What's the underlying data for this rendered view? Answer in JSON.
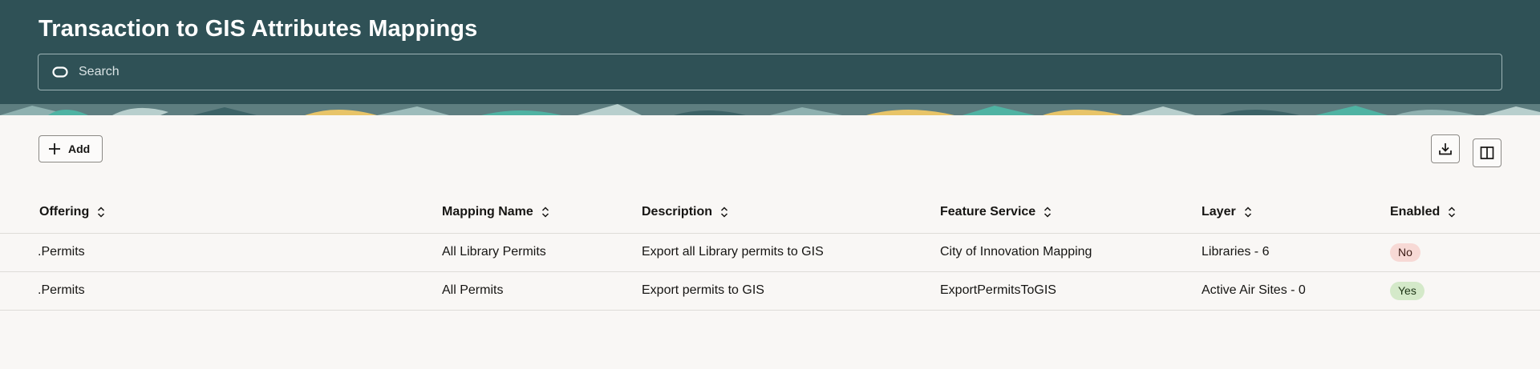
{
  "header": {
    "title": "Transaction to GIS Attributes Mappings",
    "search_placeholder": "Search"
  },
  "toolbar": {
    "add_label": "Add"
  },
  "table": {
    "columns": [
      "Offering",
      "Mapping Name",
      "Description",
      "Feature Service",
      "Layer",
      "Enabled"
    ],
    "rows": [
      {
        "offering": ".Permits",
        "mapping_name": "All Library Permits",
        "description": "Export all Library permits to GIS",
        "feature_service": "City of Innovation Mapping",
        "layer": "Libraries - 6",
        "enabled": "No"
      },
      {
        "offering": ".Permits",
        "mapping_name": "All Permits",
        "description": "Export permits to GIS",
        "feature_service": "ExportPermitsToGIS",
        "layer": "Active Air Sites - 0",
        "enabled": "Yes"
      }
    ]
  },
  "icons": [
    "search-icon",
    "plus-icon",
    "download-icon",
    "columns-icon",
    "sort-icon"
  ],
  "colors": {
    "header_bg": "#2f5156",
    "page_bg": "#f9f7f5",
    "badge_no_bg": "#f7d9d5",
    "badge_yes_bg": "#d4e9c9",
    "banner_accent_yellow": "#e8c468",
    "banner_accent_teal": "#4fb3a3"
  }
}
